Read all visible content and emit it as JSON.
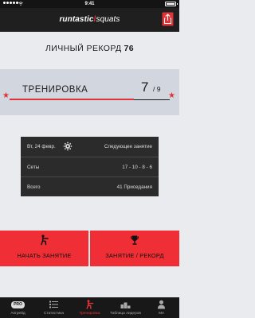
{
  "status_bar": {
    "time": "9:41"
  },
  "navbar": {
    "logo_brand": "runtastic",
    "logo_separator": "/",
    "logo_product": "squats",
    "share_icon": "share-icon"
  },
  "record": {
    "label": "ЛИЧНЫЙ РЕКОРД",
    "value": "76"
  },
  "workout": {
    "label": "ТРЕНИРОВКА",
    "current": "7",
    "total": "/ 9",
    "progress": 0.778,
    "accent": "#e03337"
  },
  "session_card": {
    "date": "Вт, 24 февр.",
    "settings_icon": "gear-icon",
    "next_label": "Следующее занятие",
    "sets_label": "Сеты",
    "sets_value": "17 - 10 - 8 - 6",
    "total_label": "Всего",
    "total_value": "41 Приседания"
  },
  "actions": {
    "start_label": "НАЧАТЬ ЗАНЯТИЕ",
    "start_icon": "squat-icon",
    "record_label": "ЗАНЯТИЕ / РЕКОРД",
    "record_icon": "trophy-icon",
    "color": "#ef2f35"
  },
  "tabs": [
    {
      "label": "Апгрейд",
      "icon": "pro-badge-icon",
      "badge": "PRO",
      "active": false
    },
    {
      "label": "Статистика",
      "icon": "list-icon",
      "active": false
    },
    {
      "label": "Тренировка",
      "icon": "squat-icon",
      "active": true
    },
    {
      "label": "Таблица лидеров",
      "icon": "podium-icon",
      "active": false
    },
    {
      "label": "Ме",
      "icon": "person-icon",
      "active": false
    }
  ]
}
